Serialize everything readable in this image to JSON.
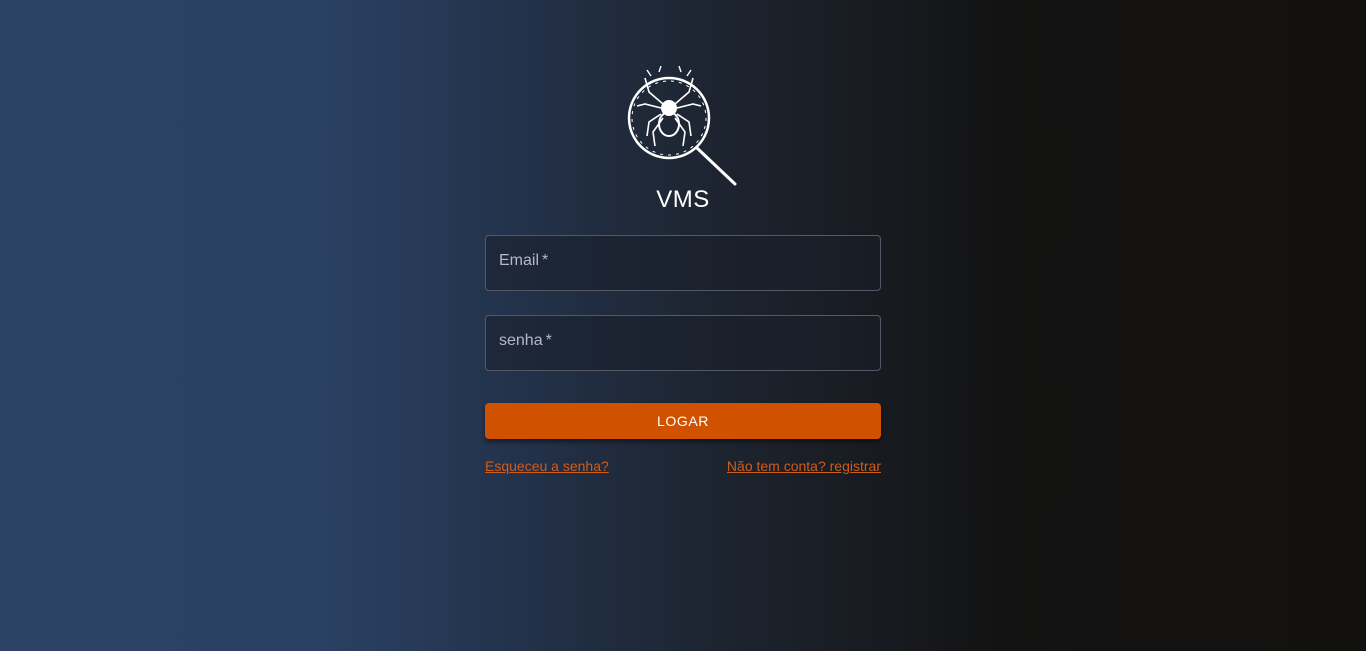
{
  "app": {
    "brand": "VMS",
    "logo_icon": "spider-magnifier-icon"
  },
  "form": {
    "email_label": "Email",
    "email_required": "*",
    "email_value": "",
    "password_label": "senha",
    "password_required": "*",
    "password_value": "",
    "submit_label": "LOGAR"
  },
  "links": {
    "forgot": "Esqueceu a senha?",
    "register": "Não tem conta? registrar"
  },
  "colors": {
    "accent": "#d05200",
    "link": "#d05c1a",
    "gradient_left": "#2c4264",
    "gradient_right": "#13110e"
  }
}
